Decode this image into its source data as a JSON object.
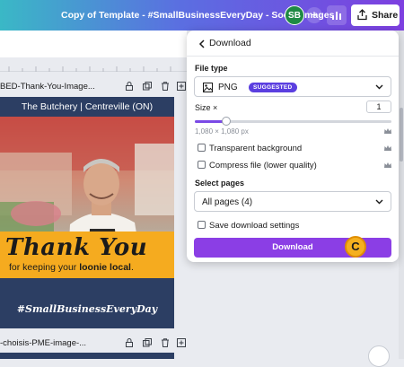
{
  "header": {
    "doc_title": "Copy of Template - #SmallBusinessEveryDay - Social Images",
    "avatar_initials": "SB",
    "plus": "+",
    "share_label": "Share"
  },
  "pages": [
    {
      "label": "BED-Thank-You-Image..."
    },
    {
      "label": "-choisis-PME-image-..."
    }
  ],
  "design": {
    "top_text": "The Butchery | Centreville (ON)",
    "headline": "Thank You",
    "sub_prefix": "for keeping your ",
    "sub_bold": "loonie local",
    "sub_suffix": ".",
    "hashtag": "#SmallBusinessEveryDay"
  },
  "download_panel": {
    "title": "Download",
    "file_type_label": "File type",
    "file_type_value": "PNG",
    "file_type_badge": "SUGGESTED",
    "size_label": "Size ×",
    "size_value": "1",
    "size_fraction": 0.16,
    "dimensions": "1,080 × 1,080 px",
    "transparent_label": "Transparent background",
    "compress_label": "Compress file (lower quality)",
    "select_pages_label": "Select pages",
    "pages_value": "All pages (4)",
    "save_settings_label": "Save download settings",
    "download_button": "Download"
  },
  "cursor_label": "C",
  "colors": {
    "accent": "#8b3ee5",
    "badge": "#5b3fe0",
    "banner": "#f5ab1f",
    "design_bg": "#2c3e63"
  }
}
